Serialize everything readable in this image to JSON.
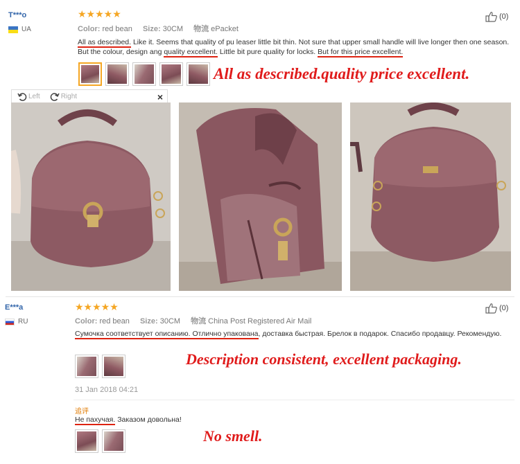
{
  "review1": {
    "user": "T***o",
    "country": "UA",
    "stars": "★★★★★",
    "color_label": "Color:",
    "color_value": "red bean",
    "size_label": "Size:",
    "size_value": "30CM",
    "shipping_label": "物流",
    "shipping_value": "ePacket",
    "helpful_count": "(0)",
    "text_part1": "All as described.",
    "text_part2": " Like it. Seems that quality of pu leaser little bit thin. Not sure that upper small handle will live longer then one season. But the colour, design ang ",
    "text_part3": "quality excellent.",
    "text_part4": " Little bit pure quality for locks. ",
    "text_part5": "But for this price excellent.",
    "annotation": "All as described.quality price excellent.",
    "viewer_left": "Left",
    "viewer_right": "Right",
    "viewer_close": "×"
  },
  "review2": {
    "user": "E***a",
    "country": "RU",
    "stars": "★★★★★",
    "color_label": "Color:",
    "color_value": "red bean",
    "size_label": "Size:",
    "size_value": "30CM",
    "shipping_label": "物流",
    "shipping_value": "China Post Registered Air Mail",
    "helpful_count": "(0)",
    "text_part1": "Сумочка соответствует описанию. Отлично упакована",
    "text_part2": ", доставка быстрая. Брелок в подарок. Спасибо продавцу. Рекомендую.",
    "annotation": "Description consistent, excellent packaging.",
    "date": "31 Jan 2018 04:21",
    "followup_label": "追评",
    "followup_part1": "Не пахучая.",
    "followup_part2": " Заказом довольна!",
    "followup_annotation": "No smell."
  },
  "colors": {
    "accent_red": "#e01b1b",
    "star_orange": "#f5a623",
    "user_blue": "#3366aa"
  }
}
